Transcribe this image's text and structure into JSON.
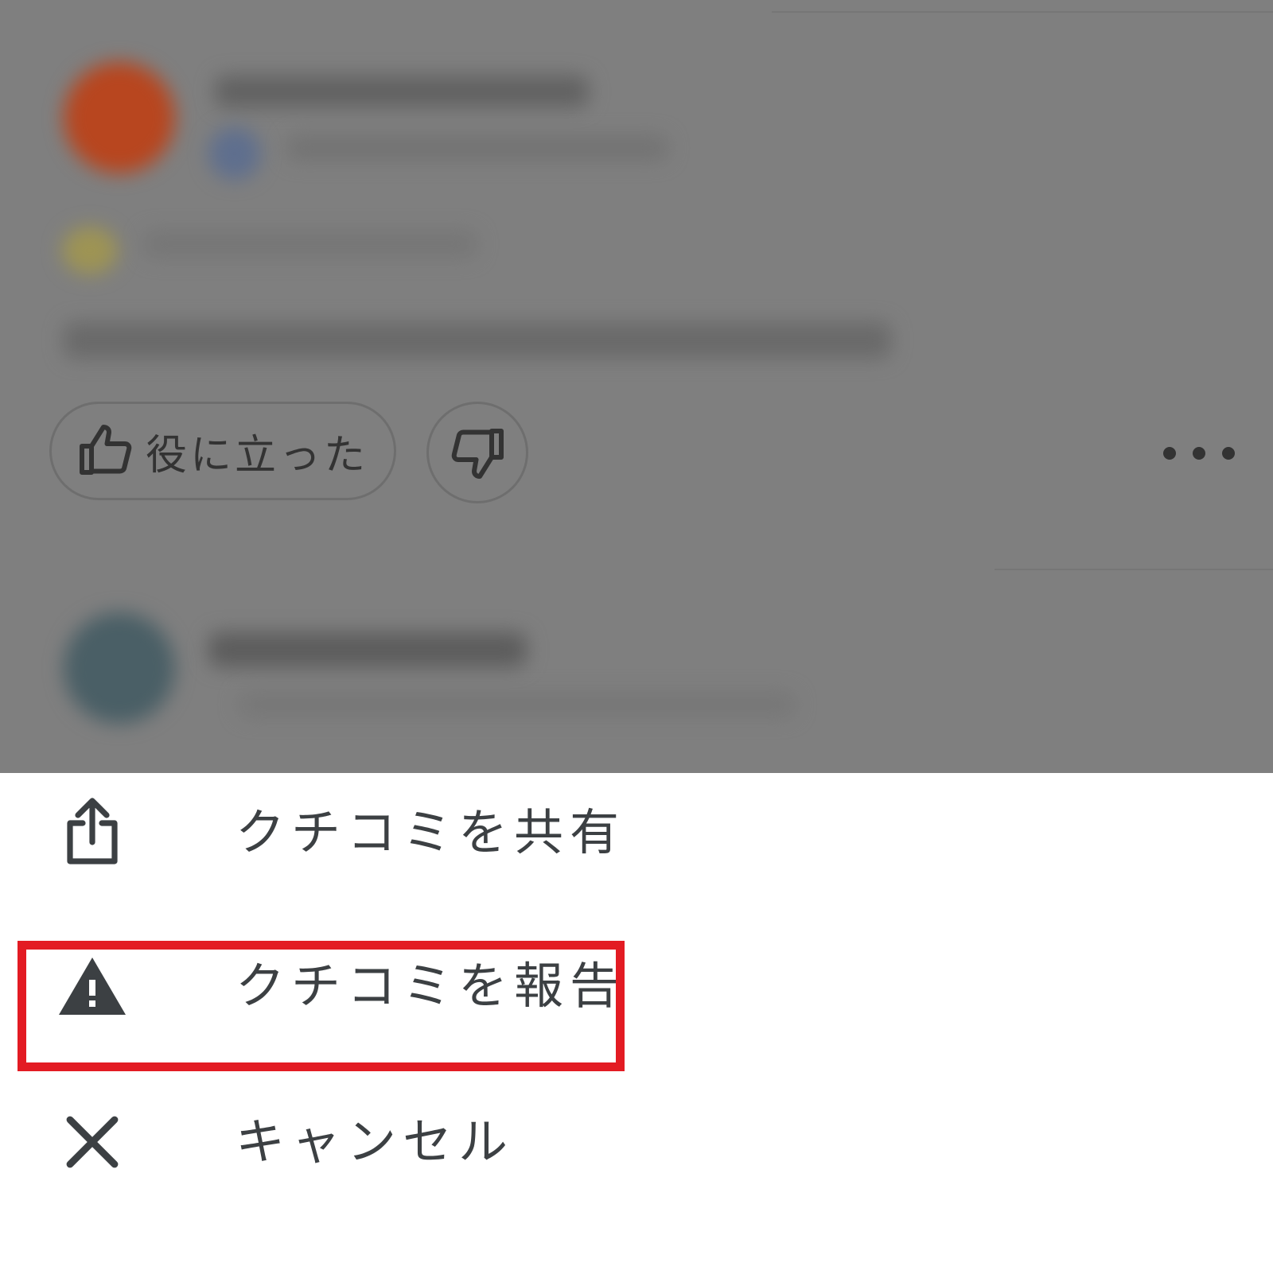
{
  "review": {
    "helpful_label": "役に立った"
  },
  "menu": {
    "items": [
      {
        "label": "クチコミを共有",
        "icon": "share-icon"
      },
      {
        "label": "クチコミを報告",
        "icon": "warning-icon"
      },
      {
        "label": "キャンセル",
        "icon": "close-icon"
      }
    ]
  },
  "colors": {
    "highlight": "#e31b23",
    "backdrop": "#7f7f7f",
    "text": "#3c4043"
  }
}
